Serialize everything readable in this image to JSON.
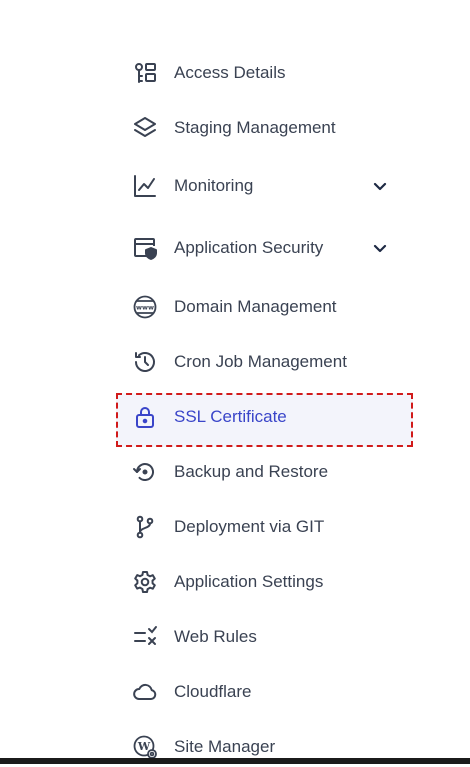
{
  "colors": {
    "text": "#3a4252",
    "active_text": "#3a45c9",
    "highlight_border": "#d11a1a",
    "active_bg": "#f3f4fb"
  },
  "menu": {
    "items": [
      {
        "label": "Access Details",
        "icon": "access-details-icon"
      },
      {
        "label": "Staging Management",
        "icon": "layers-icon"
      },
      {
        "label": "Monitoring",
        "icon": "line-chart-icon",
        "expandable": true
      },
      {
        "label": "Application Security",
        "icon": "browser-shield-icon",
        "expandable": true
      },
      {
        "label": "Domain Management",
        "icon": "www-globe-icon"
      },
      {
        "label": "Cron Job Management",
        "icon": "history-clock-icon"
      },
      {
        "label": "SSL Certificate",
        "icon": "lock-icon",
        "active": true
      },
      {
        "label": "Backup and Restore",
        "icon": "restore-icon"
      },
      {
        "label": "Deployment via GIT",
        "icon": "git-branch-icon"
      },
      {
        "label": "Application Settings",
        "icon": "gear-icon"
      },
      {
        "label": "Web Rules",
        "icon": "rules-icon"
      },
      {
        "label": "Cloudflare",
        "icon": "cloud-icon"
      },
      {
        "label": "Site Manager",
        "icon": "wordpress-gear-icon"
      }
    ]
  }
}
